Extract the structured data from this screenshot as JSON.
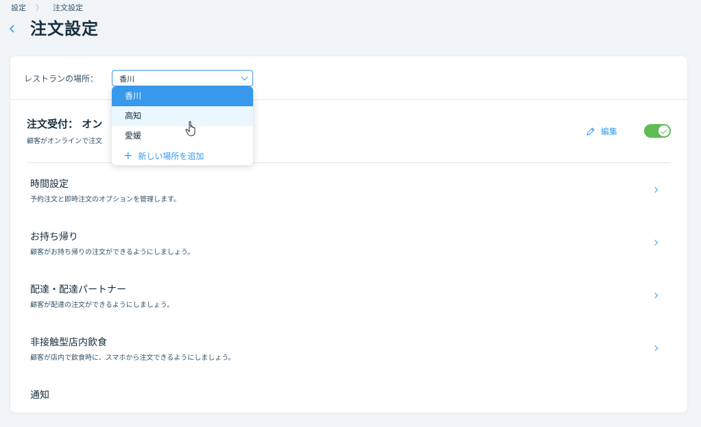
{
  "breadcrumb": {
    "root": "設定",
    "current": "注文設定"
  },
  "header": {
    "title": "注文設定"
  },
  "location": {
    "label": "レストランの場所：",
    "selected": "香川",
    "options": [
      "香川",
      "高知",
      "愛媛"
    ],
    "add_label": "新しい場所を追加"
  },
  "accept": {
    "title": "注文受付：  オン",
    "desc": "顧客がオンラインで注文",
    "edit_label": "編集",
    "enabled": true
  },
  "settings": [
    {
      "title": "時間設定",
      "desc": "予約注文と即時注文のオプションを管理します。"
    },
    {
      "title": "お持ち帰り",
      "desc": "顧客がお持ち帰りの注文ができるようにしましょう。"
    },
    {
      "title": "配達・配達パートナー",
      "desc": "顧客が配達の注文ができるようにしましょう。"
    },
    {
      "title": "非接触型店内飲食",
      "desc": "顧客が店内で飲食時に、スマホから注文できるようにしましょう。"
    },
    {
      "title": "通知",
      "desc": ""
    }
  ],
  "colors": {
    "accent": "#3899ec",
    "toggle_on": "#60bc57",
    "background": "#f0f4f7"
  }
}
